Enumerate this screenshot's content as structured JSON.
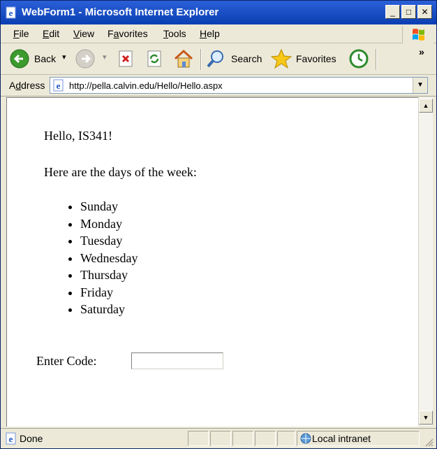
{
  "window": {
    "title": "WebForm1 - Microsoft Internet Explorer",
    "minimize_glyph": "_",
    "maximize_glyph": "□",
    "close_glyph": "✕"
  },
  "menu": {
    "items": [
      {
        "key": "F",
        "rest": "ile"
      },
      {
        "key": "E",
        "rest": "dit"
      },
      {
        "key": "V",
        "rest": "iew"
      },
      {
        "key": "a",
        "pre": "F",
        "rest": "vorites"
      },
      {
        "key": "T",
        "rest": "ools"
      },
      {
        "key": "H",
        "rest": "elp"
      }
    ]
  },
  "toolbar": {
    "back_label": "Back",
    "search_label": "Search",
    "favorites_label": "Favorites",
    "chevron": "»",
    "dropdown_glyph": "▾"
  },
  "address": {
    "label_key": "d",
    "label_pre": "A",
    "label_rest": "dress",
    "url": "http://pella.calvin.edu/Hello/Hello.aspx",
    "dropdown_glyph": "▼"
  },
  "page": {
    "greeting": "Hello, IS341!",
    "days_label": "Here are the days of the week:",
    "days": [
      "Sunday",
      "Monday",
      "Tuesday",
      "Wednesday",
      "Thursday",
      "Friday",
      "Saturday"
    ],
    "code_label": "Enter Code:",
    "code_value": ""
  },
  "scrollbar": {
    "up_glyph": "▲",
    "down_glyph": "▼"
  },
  "status": {
    "text": "Done",
    "zone": "Local intranet"
  },
  "colors": {
    "titlebar": "#0a3fb3",
    "chrome": "#ece9d8",
    "content_bg": "#ffffff"
  }
}
